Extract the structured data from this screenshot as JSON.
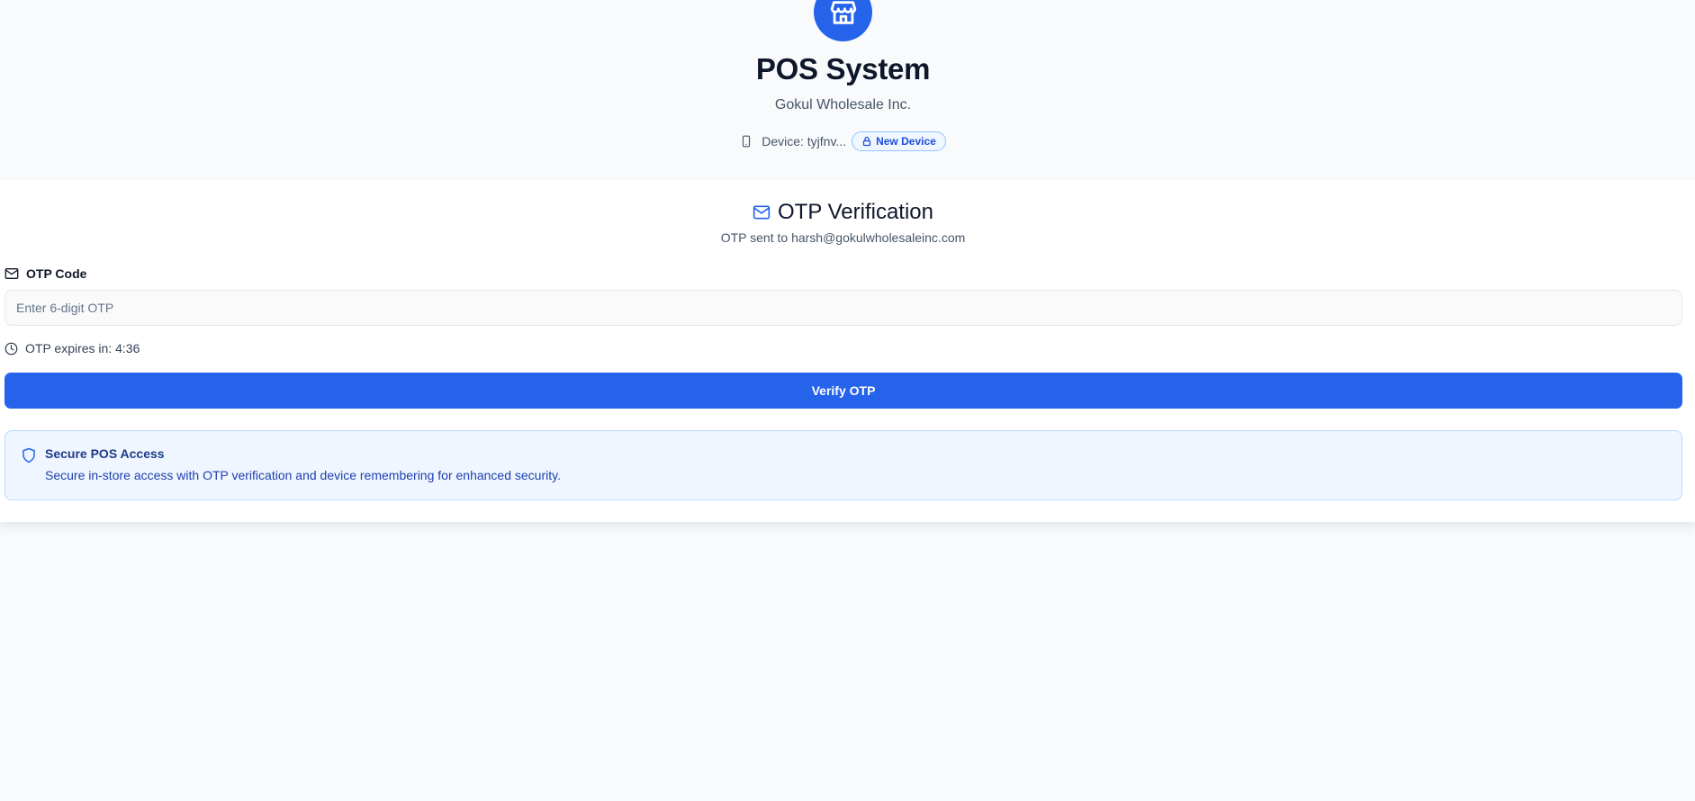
{
  "header": {
    "title": "POS System",
    "company": "Gokul Wholesale Inc.",
    "device_label": "Device: tyjfnv...",
    "device_badge": "New Device",
    "logo_icon": "store-icon",
    "accent": "#2563eb"
  },
  "otp_card": {
    "title": "OTP Verification",
    "subtitle": "OTP sent to harsh@gokulwholesaleinc.com",
    "field_label": "OTP Code",
    "input_placeholder": "Enter 6-digit OTP",
    "input_value": "",
    "expiry_text": "OTP expires in: 4:36",
    "verify_label": "Verify OTP"
  },
  "security_note": {
    "title": "Secure POS Access",
    "text": "Secure in-store access with OTP verification and device remembering for enhanced security.",
    "icon": "shield-icon"
  }
}
